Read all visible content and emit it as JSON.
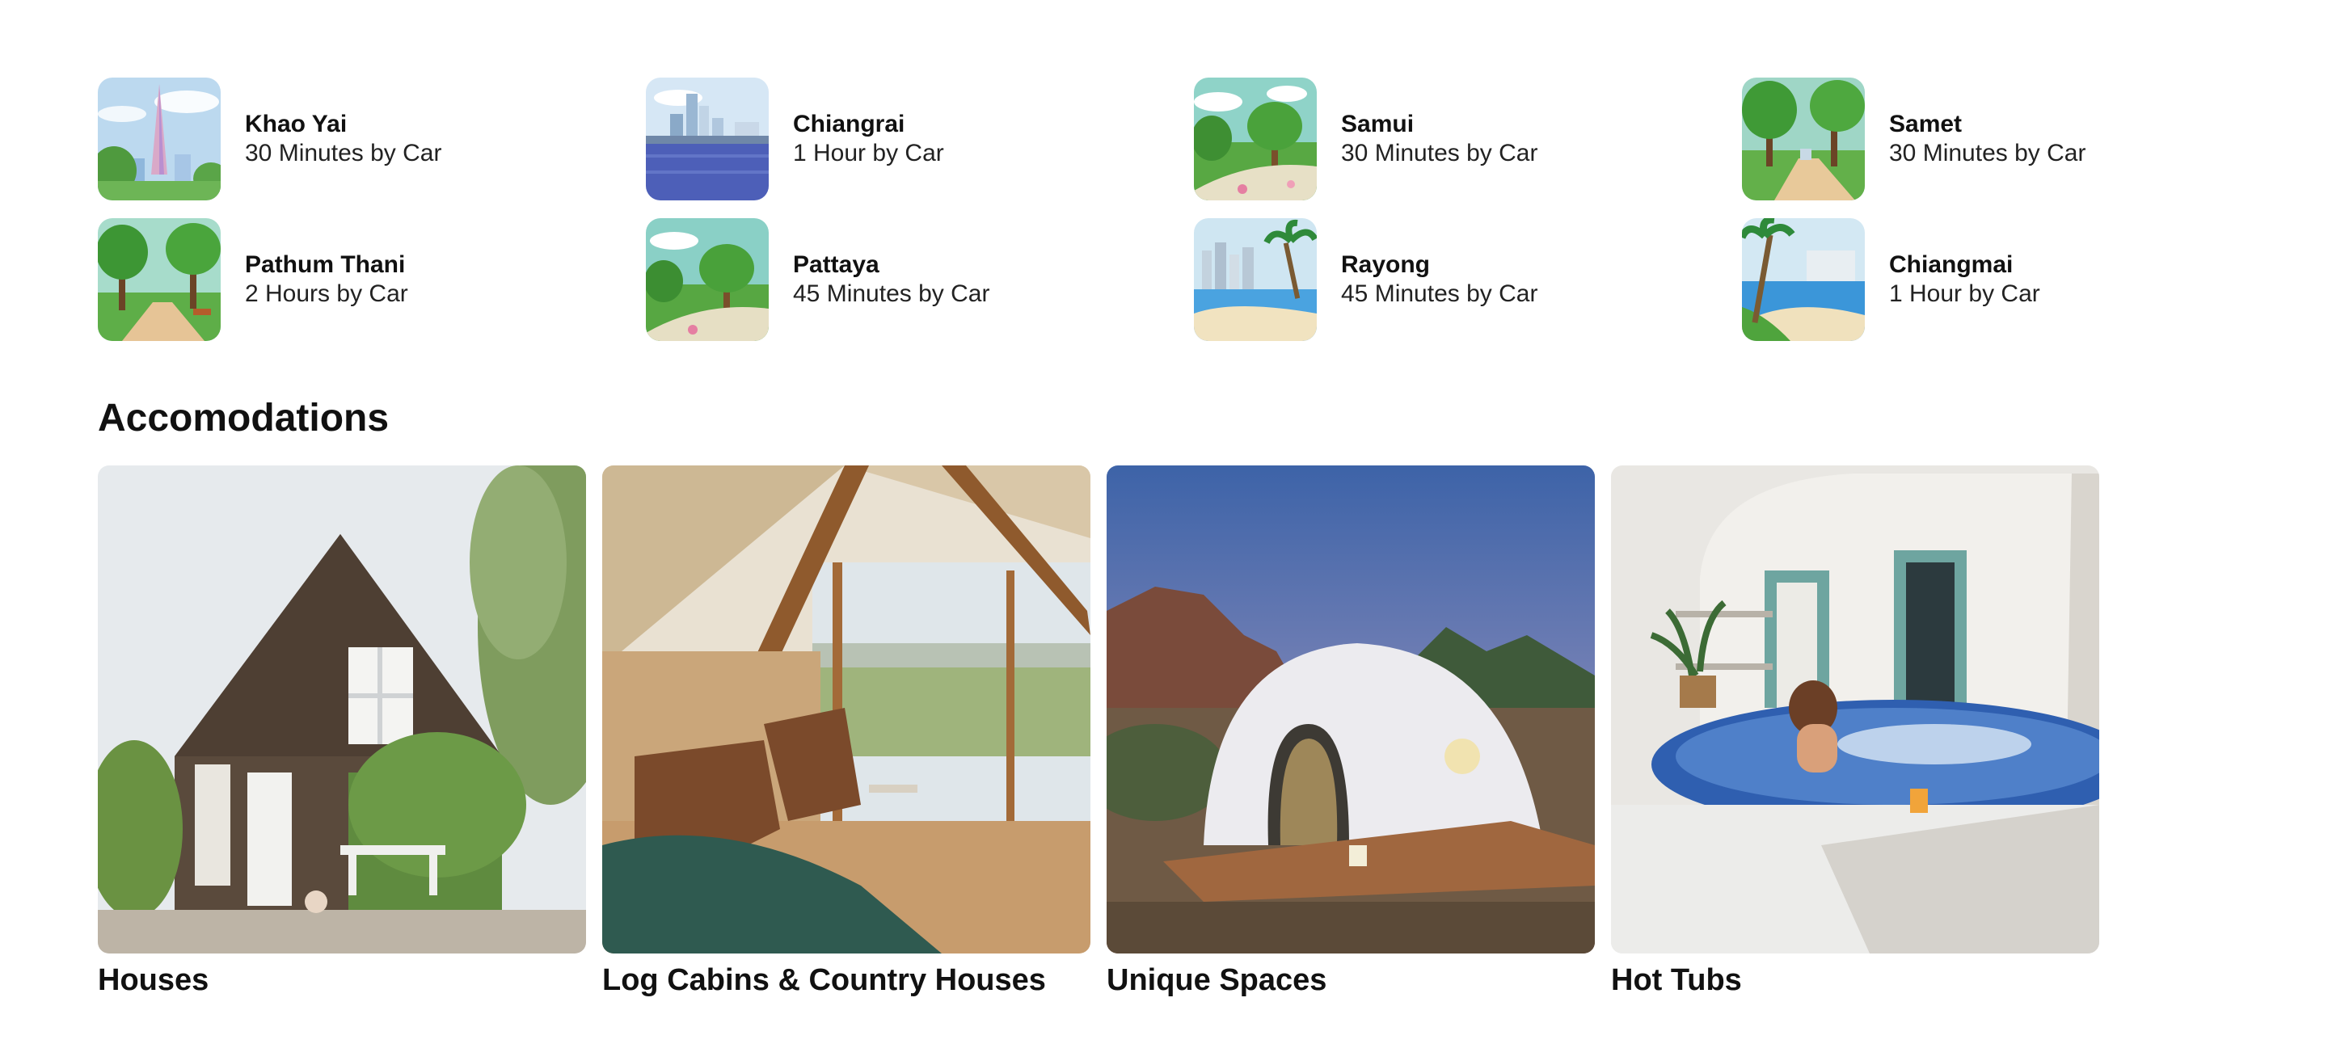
{
  "destinations": [
    {
      "name": "Khao Yai",
      "distance": "30 Minutes by Car",
      "icon": "city-tower-illustration"
    },
    {
      "name": "Chiangrai",
      "distance": "1 Hour by Car",
      "icon": "city-waterfront-illustration"
    },
    {
      "name": "Samui",
      "distance": "30 Minutes by Car",
      "icon": "park-illustration"
    },
    {
      "name": "Samet",
      "distance": "30 Minutes by Car",
      "icon": "park-path-illustration"
    },
    {
      "name": "Pathum Thani",
      "distance": "2 Hours by Car",
      "icon": "park-path-illustration"
    },
    {
      "name": "Pattaya",
      "distance": "45 Minutes by Car",
      "icon": "park-illustration"
    },
    {
      "name": "Rayong",
      "distance": "45 Minutes by Car",
      "icon": "beach-city-illustration"
    },
    {
      "name": "Chiangmai",
      "distance": "1 Hour by Car",
      "icon": "beach-palm-illustration"
    }
  ],
  "accommodations": {
    "title": "Accomodations",
    "items": [
      {
        "label": "Houses",
        "image": "wooden-house-photo"
      },
      {
        "label": "Log Cabins & Country Houses",
        "image": "a-frame-cabin-interior-photo"
      },
      {
        "label": "Unique Spaces",
        "image": "geodesic-dome-photo"
      },
      {
        "label": "Hot Tubs",
        "image": "hot-tub-photo"
      }
    ]
  }
}
